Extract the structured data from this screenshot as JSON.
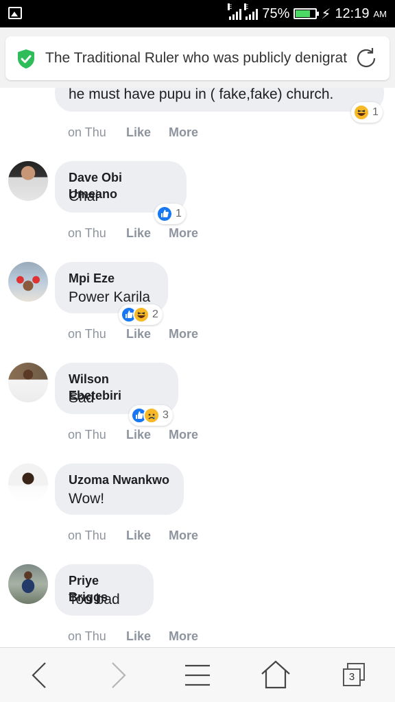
{
  "status_bar": {
    "sim1_label": "E",
    "sim2_label": "E",
    "battery": "75%",
    "time": "12:19",
    "ampm": "AM",
    "battery_level": 0.75
  },
  "url_bar": {
    "title": "The Traditional Ruler who was publicly denigrated"
  },
  "comments": [
    {
      "name": "",
      "text": "he must have pupu in ( fake,fake) church.",
      "time": "on Thu",
      "like": "Like",
      "more": "More",
      "reactions": [
        "haha"
      ],
      "reaction_count": "1"
    },
    {
      "name": "Dave Obi Umeano",
      "text": "Chai",
      "time": "on Thu",
      "like": "Like",
      "more": "More",
      "reactions": [
        "like"
      ],
      "reaction_count": "1"
    },
    {
      "name": "Mpi Eze",
      "text": "Power Karila",
      "time": "on Thu",
      "like": "Like",
      "more": "More",
      "reactions": [
        "like",
        "haha"
      ],
      "reaction_count": "2"
    },
    {
      "name": "Wilson Ebetebiri",
      "text": "Sad",
      "time": "on Thu",
      "like": "Like",
      "more": "More",
      "reactions": [
        "like",
        "sad"
      ],
      "reaction_count": "3"
    },
    {
      "name": "Uzoma Nwankwo",
      "text": "Wow!",
      "time": "on Thu",
      "like": "Like",
      "more": "More",
      "reactions": [],
      "reaction_count": ""
    },
    {
      "name": "Priye Briggs",
      "text": "Too bad",
      "time": "on Thu",
      "like": "Like",
      "more": "More",
      "reactions": [],
      "reaction_count": ""
    }
  ],
  "nav": {
    "tab_count": "3",
    "icons": [
      "back-icon",
      "forward-icon",
      "menu-icon",
      "home-icon",
      "tabs-icon"
    ]
  },
  "colors": {
    "accent_green": "#2ebd59",
    "like_blue": "#1877f2",
    "bubble_bg": "#eceef1"
  }
}
